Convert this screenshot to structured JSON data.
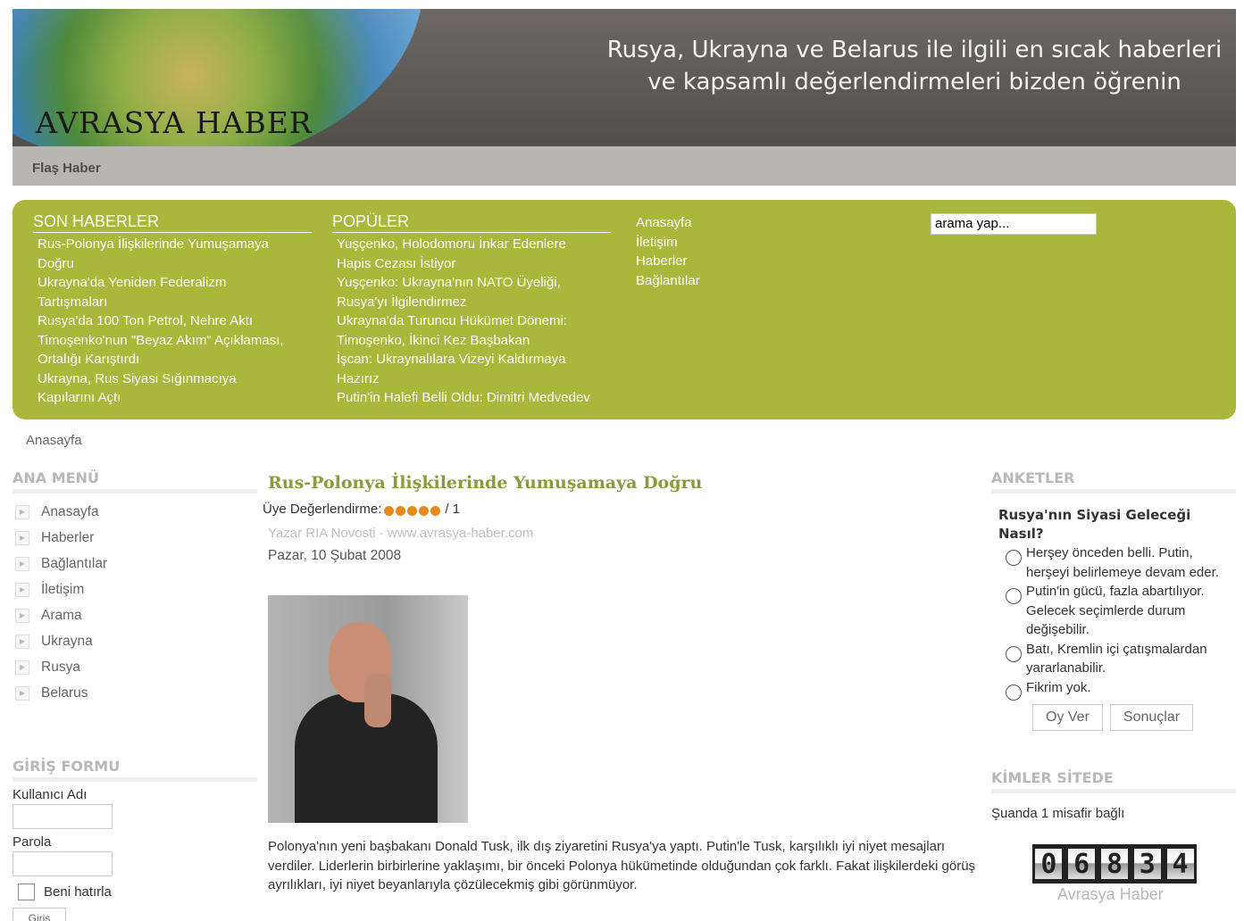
{
  "header": {
    "logo": "AVRASYA  HABER",
    "slogan_line1": "Rusya, Ukrayna ve Belarus ile ilgili en sıcak haberleri",
    "slogan_line2": "ve kapsamlı değerlendirmeleri bizden öğrenin",
    "flash_label": "Flaş Haber"
  },
  "topbox": {
    "latest_title": "SON HABERLER",
    "latest_items": [
      "Rus-Polonya İlişkilerinde Yumuşamaya",
      "Doğru",
      "Ukrayna'da Yeniden Federalizm",
      "Tartışmaları",
      "Rusya'da 100 Ton Petrol, Nehre Aktı",
      "Timoşenko'nun \"Beyaz Akım\" Açıklaması,",
      "Ortalığı Karıştırdı",
      "Ukrayna, Rus Siyasi Sığınmacıya",
      "Kapılarını Açtı"
    ],
    "popular_title": "POPÜLER",
    "popular_items": [
      "Yuşçenko, Holodomoru İnkar Edenlere",
      "Hapis Cezası İstiyor",
      "Yuşçenko: Ukrayna'nın NATO Üyeliği,",
      "Rusya'yı İlgilendirmez",
      "Ukrayna'da Turuncu Hükümet Dönemi:",
      "Timoşenko, İkinci Kez Başbakan",
      "İşcan: Ukraynalılara Vizeyi Kaldırmaya",
      "Hazırız",
      "Putin'in Halefi Belli Oldu: Dimitri Medvedev"
    ],
    "nav_links": [
      "Anasayfa",
      "İletişim",
      "Haberler",
      "Bağlantılar"
    ],
    "search_placeholder": "arama yap..."
  },
  "breadcrumb": "Anasayfa",
  "main_menu": {
    "title": "ANA MENÜ",
    "items": [
      "Anasayfa",
      "Haberler",
      "Bağlantılar",
      "İletişim",
      "Arama",
      "Ukrayna",
      "Rusya",
      "Belarus"
    ]
  },
  "login": {
    "title": "GİRİŞ FORMU",
    "username_label": "Kullanıcı Adı",
    "password_label": "Parola",
    "remember_label": "Beni hatırla",
    "submit_label": "Giriş"
  },
  "article": {
    "title": "Rus-Polonya İlişkilerinde Yumuşamaya Doğru",
    "rating_label": "Üye Değerlendirme:",
    "rating_value": 5,
    "rating_suffix": "/ 1",
    "author": "Yazar RIA Novosti - www.avrasya-haber.com",
    "date": "Pazar, 10 Şubat 2008",
    "body": "Polonya'nın yeni başbakanı Donald Tusk, ilk dış ziyaretini Rusya'ya yaptı. Putin'le Tusk, karşılıklı iyi niyet mesajları verdiler. Liderlerin birbirlerine yaklaşımı, bir önceki Polonya hükümetinde olduğundan çok farklı. Fakat ilişkilerdeki görüş ayrılıkları, iyi niyet beyanlarıyla çözülecekmiş gibi görünmüyor."
  },
  "poll": {
    "title": "ANKETLER",
    "question": "Rusya'nın Siyasi Geleceği Nasıl?",
    "options": [
      "Herşey önceden belli. Putin, herşeyi belirlemeye devam eder.",
      "Putin'in gücü, fazla abartılıyor. Gelecek seçimlerde durum değişebilir.",
      "Batı, Kremlin içi çatışmalardan yararlanabilir.",
      "Fikrim yok."
    ],
    "vote_label": "Oy Ver",
    "results_label": "Sonuçlar"
  },
  "who_online": {
    "title": "KİMLER SİTEDE",
    "text": "Şuanda 1 misafir bağlı",
    "counter_digits": [
      "0",
      "6",
      "8",
      "3",
      "4"
    ],
    "counter_label": "Avrasya Haber"
  },
  "colors": {
    "accent_green": "#a9b83a",
    "title_green": "#8e9a3a",
    "header_gray": "#5c5854",
    "rating_orange": "#e8891c"
  }
}
